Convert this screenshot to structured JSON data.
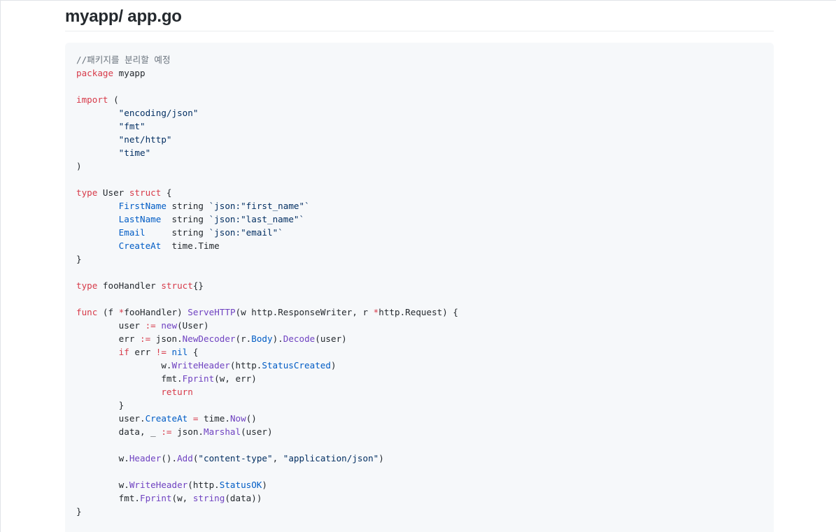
{
  "page": {
    "title": "myapp/ app.go"
  },
  "colors": {
    "comment": "#6a737d",
    "keyword": "#d73a49",
    "string": "#032f62",
    "field": "#005cc5",
    "function": "#6f42c1",
    "plain": "#24292e",
    "code_background": "#f6f8fa"
  },
  "code": {
    "lines": [
      [
        {
          "t": "//패키지를 분리할 예정",
          "c": "comment"
        }
      ],
      [
        {
          "t": "package",
          "c": "kw"
        },
        {
          "t": " myapp",
          "c": "plain"
        }
      ],
      [],
      [
        {
          "t": "import",
          "c": "kw"
        },
        {
          "t": " (",
          "c": "plain"
        }
      ],
      [
        {
          "t": "\t",
          "c": "plain"
        },
        {
          "t": "\"encoding/json\"",
          "c": "str"
        }
      ],
      [
        {
          "t": "\t",
          "c": "plain"
        },
        {
          "t": "\"fmt\"",
          "c": "str"
        }
      ],
      [
        {
          "t": "\t",
          "c": "plain"
        },
        {
          "t": "\"net/http\"",
          "c": "str"
        }
      ],
      [
        {
          "t": "\t",
          "c": "plain"
        },
        {
          "t": "\"time\"",
          "c": "str"
        }
      ],
      [
        {
          "t": ")",
          "c": "plain"
        }
      ],
      [],
      [
        {
          "t": "type",
          "c": "kw"
        },
        {
          "t": " User ",
          "c": "plain"
        },
        {
          "t": "struct",
          "c": "kw"
        },
        {
          "t": " {",
          "c": "plain"
        }
      ],
      [
        {
          "t": "\t",
          "c": "plain"
        },
        {
          "t": "FirstName",
          "c": "field"
        },
        {
          "t": " string ",
          "c": "plain"
        },
        {
          "t": "`json:\"first_name\"`",
          "c": "str"
        }
      ],
      [
        {
          "t": "\t",
          "c": "plain"
        },
        {
          "t": "LastName",
          "c": "field"
        },
        {
          "t": "  string ",
          "c": "plain"
        },
        {
          "t": "`json:\"last_name\"`",
          "c": "str"
        }
      ],
      [
        {
          "t": "\t",
          "c": "plain"
        },
        {
          "t": "Email",
          "c": "field"
        },
        {
          "t": "     string ",
          "c": "plain"
        },
        {
          "t": "`json:\"email\"`",
          "c": "str"
        }
      ],
      [
        {
          "t": "\t",
          "c": "plain"
        },
        {
          "t": "CreateAt",
          "c": "field"
        },
        {
          "t": "  time.Time",
          "c": "plain"
        }
      ],
      [
        {
          "t": "}",
          "c": "plain"
        }
      ],
      [],
      [
        {
          "t": "type",
          "c": "kw"
        },
        {
          "t": " fooHandler ",
          "c": "plain"
        },
        {
          "t": "struct",
          "c": "kw"
        },
        {
          "t": "{}",
          "c": "plain"
        }
      ],
      [],
      [
        {
          "t": "func",
          "c": "kw"
        },
        {
          "t": " (f ",
          "c": "plain"
        },
        {
          "t": "*",
          "c": "kw"
        },
        {
          "t": "fooHandler) ",
          "c": "plain"
        },
        {
          "t": "ServeHTTP",
          "c": "fn"
        },
        {
          "t": "(w http.ResponseWriter, r ",
          "c": "plain"
        },
        {
          "t": "*",
          "c": "kw"
        },
        {
          "t": "http.Request) {",
          "c": "plain"
        }
      ],
      [
        {
          "t": "\tuser ",
          "c": "plain"
        },
        {
          "t": ":=",
          "c": "kw"
        },
        {
          "t": " ",
          "c": "plain"
        },
        {
          "t": "new",
          "c": "fn"
        },
        {
          "t": "(User)",
          "c": "plain"
        }
      ],
      [
        {
          "t": "\terr ",
          "c": "plain"
        },
        {
          "t": ":=",
          "c": "kw"
        },
        {
          "t": " json.",
          "c": "plain"
        },
        {
          "t": "NewDecoder",
          "c": "fn"
        },
        {
          "t": "(r.",
          "c": "plain"
        },
        {
          "t": "Body",
          "c": "field"
        },
        {
          "t": ").",
          "c": "plain"
        },
        {
          "t": "Decode",
          "c": "fn"
        },
        {
          "t": "(user)",
          "c": "plain"
        }
      ],
      [
        {
          "t": "\t",
          "c": "plain"
        },
        {
          "t": "if",
          "c": "kw"
        },
        {
          "t": " err ",
          "c": "plain"
        },
        {
          "t": "!=",
          "c": "kw"
        },
        {
          "t": " ",
          "c": "plain"
        },
        {
          "t": "nil",
          "c": "field"
        },
        {
          "t": " {",
          "c": "plain"
        }
      ],
      [
        {
          "t": "\t\tw.",
          "c": "plain"
        },
        {
          "t": "WriteHeader",
          "c": "fn"
        },
        {
          "t": "(http.",
          "c": "plain"
        },
        {
          "t": "StatusCreated",
          "c": "field"
        },
        {
          "t": ")",
          "c": "plain"
        }
      ],
      [
        {
          "t": "\t\tfmt.",
          "c": "plain"
        },
        {
          "t": "Fprint",
          "c": "fn"
        },
        {
          "t": "(w, err)",
          "c": "plain"
        }
      ],
      [
        {
          "t": "\t\t",
          "c": "plain"
        },
        {
          "t": "return",
          "c": "kw"
        }
      ],
      [
        {
          "t": "\t}",
          "c": "plain"
        }
      ],
      [
        {
          "t": "\tuser.",
          "c": "plain"
        },
        {
          "t": "CreateAt",
          "c": "field"
        },
        {
          "t": " ",
          "c": "plain"
        },
        {
          "t": "=",
          "c": "kw"
        },
        {
          "t": " time.",
          "c": "plain"
        },
        {
          "t": "Now",
          "c": "fn"
        },
        {
          "t": "()",
          "c": "plain"
        }
      ],
      [
        {
          "t": "\tdata, _ ",
          "c": "plain"
        },
        {
          "t": ":=",
          "c": "kw"
        },
        {
          "t": " json.",
          "c": "plain"
        },
        {
          "t": "Marshal",
          "c": "fn"
        },
        {
          "t": "(user)",
          "c": "plain"
        }
      ],
      [],
      [
        {
          "t": "\tw.",
          "c": "plain"
        },
        {
          "t": "Header",
          "c": "fn"
        },
        {
          "t": "().",
          "c": "plain"
        },
        {
          "t": "Add",
          "c": "fn"
        },
        {
          "t": "(",
          "c": "plain"
        },
        {
          "t": "\"content-type\"",
          "c": "str"
        },
        {
          "t": ", ",
          "c": "plain"
        },
        {
          "t": "\"application/json\"",
          "c": "str"
        },
        {
          "t": ")",
          "c": "plain"
        }
      ],
      [],
      [
        {
          "t": "\tw.",
          "c": "plain"
        },
        {
          "t": "WriteHeader",
          "c": "fn"
        },
        {
          "t": "(http.",
          "c": "plain"
        },
        {
          "t": "StatusOK",
          "c": "field"
        },
        {
          "t": ")",
          "c": "plain"
        }
      ],
      [
        {
          "t": "\tfmt.",
          "c": "plain"
        },
        {
          "t": "Fprint",
          "c": "fn"
        },
        {
          "t": "(w, ",
          "c": "plain"
        },
        {
          "t": "string",
          "c": "fn"
        },
        {
          "t": "(data))",
          "c": "plain"
        }
      ],
      [
        {
          "t": "}",
          "c": "plain"
        }
      ]
    ]
  }
}
